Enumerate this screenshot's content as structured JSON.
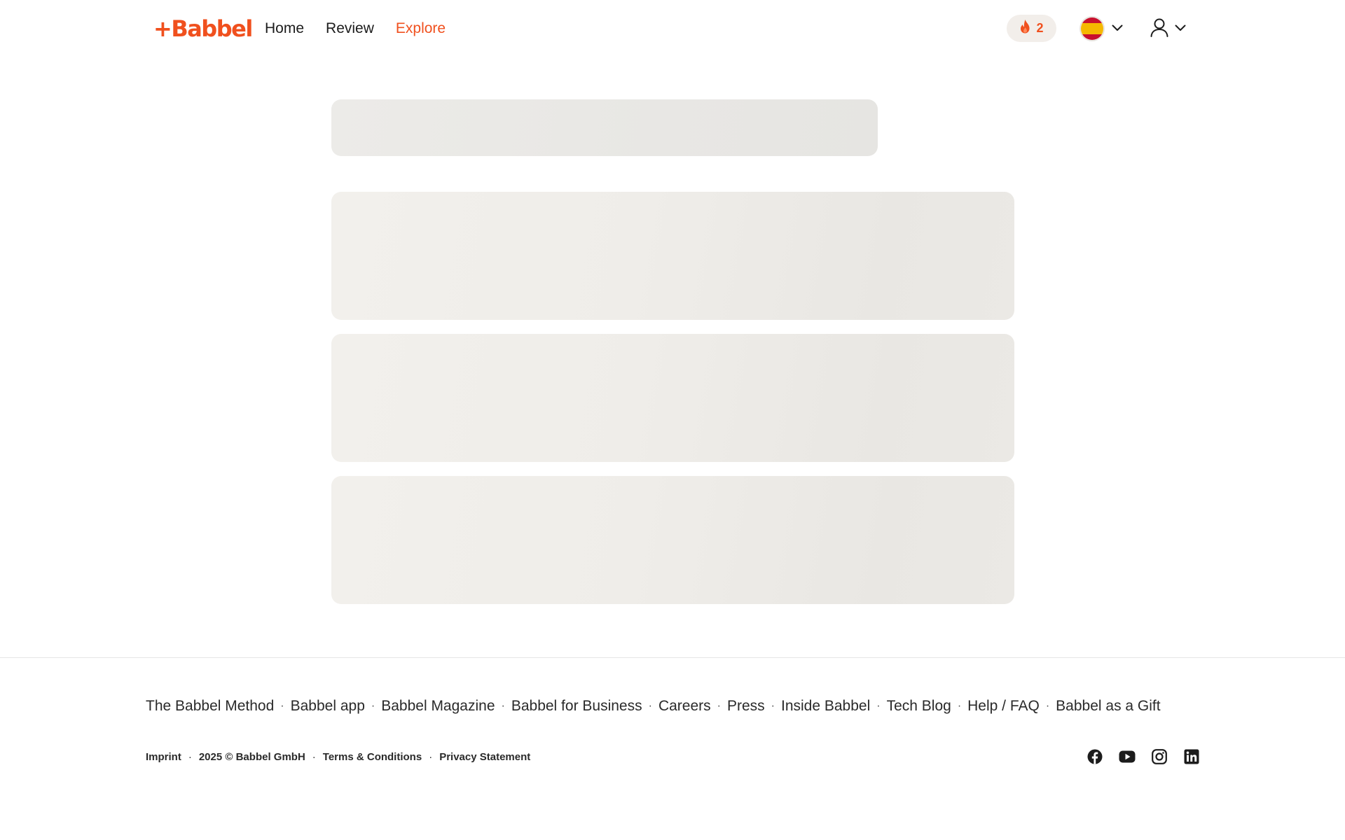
{
  "header": {
    "logo_text": "+Babbel",
    "nav": [
      {
        "label": "Home",
        "active": false
      },
      {
        "label": "Review",
        "active": false
      },
      {
        "label": "Explore",
        "active": true
      }
    ],
    "streak_count": "2",
    "language_flag": "spain-flag",
    "colors": {
      "accent": "#f0501e",
      "streak_bg": "#f2eeea"
    }
  },
  "footer": {
    "links": [
      "The Babbel Method",
      "Babbel app",
      "Babbel Magazine",
      "Babbel for Business",
      "Careers",
      "Press",
      "Inside Babbel",
      "Tech Blog",
      "Help / FAQ",
      "Babbel as a Gift"
    ],
    "legal": [
      "Imprint",
      "2025 © Babbel GmbH",
      "Terms & Conditions",
      "Privacy Statement"
    ],
    "separator": "·",
    "social": [
      "facebook-icon",
      "youtube-icon",
      "instagram-icon",
      "linkedin-icon"
    ]
  }
}
